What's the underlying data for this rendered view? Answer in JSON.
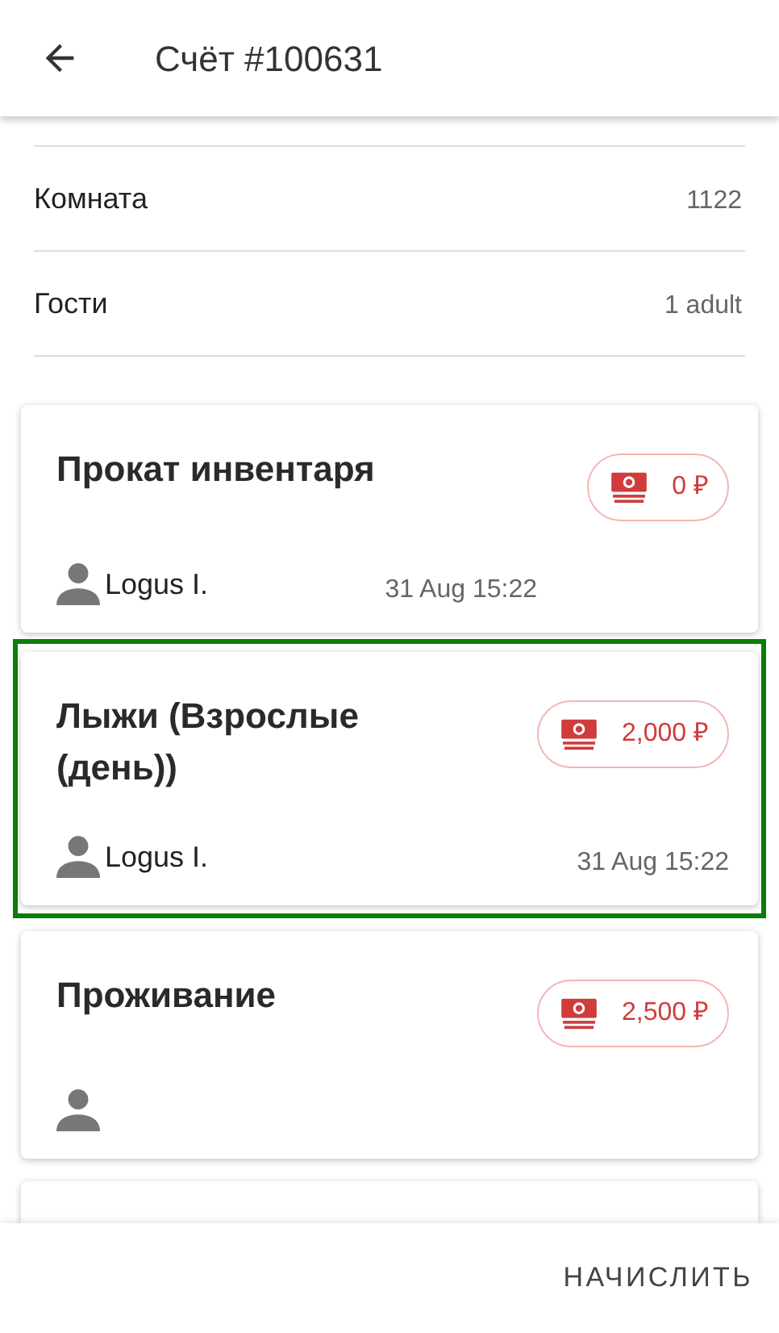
{
  "header": {
    "title": "Счёт #100631"
  },
  "details": [
    {
      "label": "Комната",
      "value": "1122"
    },
    {
      "label": "Гости",
      "value": "1 adult"
    }
  ],
  "charges": [
    {
      "title": "Прокат инвентаря",
      "amount": "0 ₽",
      "user": "Logus I.",
      "date": "31 Aug 15:22",
      "selected": false
    },
    {
      "title": "Лыжи (Взрослые (день))",
      "amount": "2,000 ₽",
      "user": "Logus I.",
      "date": "31 Aug 15:22",
      "selected": true
    },
    {
      "title": "Проживание",
      "amount": "2,500 ₽",
      "selected": false
    },
    {
      "selected": false
    }
  ],
  "action_button": "НАЧИСЛИТЬ"
}
